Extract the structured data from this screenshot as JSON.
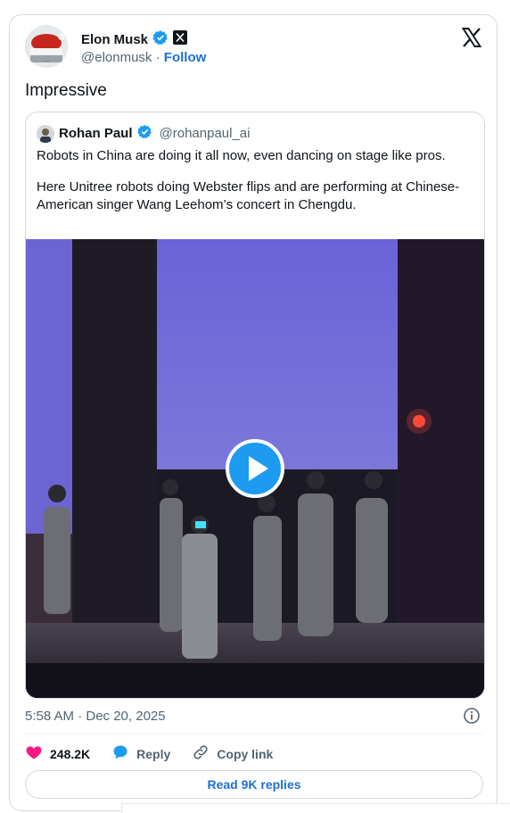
{
  "author": {
    "name": "Elon Musk",
    "handle": "@elonmusk",
    "separator": "·",
    "follow_label": "Follow"
  },
  "tweet_text": "Impressive",
  "quoted": {
    "name": "Rohan Paul",
    "handle": "@rohanpaul_ai",
    "paragraphs": [
      "Robots in China are doing it all now, even dancing on stage like pros.",
      "Here Unitree robots doing Webster flips and are performing at Chinese-American singer Wang Leehom’s concert in Chengdu."
    ]
  },
  "meta": {
    "timestamp": "5:58 AM · Dec 20, 2025"
  },
  "actions": {
    "likes": "248.2K",
    "reply_label": "Reply",
    "copy_link_label": "Copy link"
  },
  "read_replies_label": "Read 9K replies",
  "colors": {
    "accent": "#1d9bf0",
    "link": "#1d6fd6",
    "like": "#f91880",
    "muted": "#536471",
    "border": "#cfd9de"
  },
  "icons": {
    "verified": "verified-badge-icon",
    "affiliation": "x-affiliation-icon",
    "logo": "x-logo-icon",
    "play": "play-icon",
    "info": "info-icon",
    "like": "heart-icon",
    "reply": "reply-icon",
    "copy": "link-icon"
  }
}
